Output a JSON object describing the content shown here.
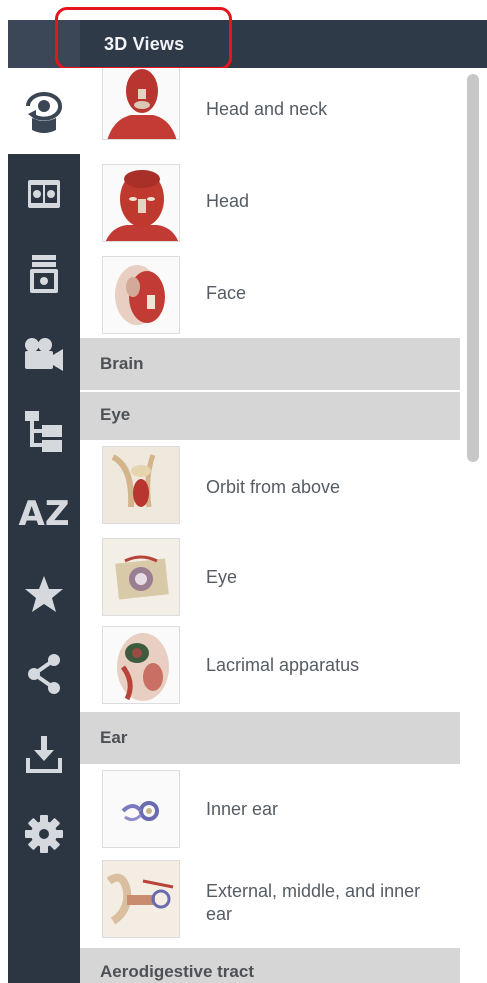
{
  "header": {
    "title": "3D Views"
  },
  "sidebar": {
    "items": [
      {
        "icon": "3d-rotate-icon",
        "active": true
      },
      {
        "icon": "split-panel-icon",
        "active": false
      },
      {
        "icon": "stacked-layers-icon",
        "active": false
      },
      {
        "icon": "video-camera-icon",
        "active": false
      },
      {
        "icon": "hierarchy-tree-icon",
        "active": false
      },
      {
        "icon": "a-to-z-icon",
        "active": false
      },
      {
        "icon": "star-icon",
        "active": false
      },
      {
        "icon": "share-icon",
        "active": false
      },
      {
        "icon": "download-icon",
        "active": false
      },
      {
        "icon": "gear-icon",
        "active": false
      }
    ],
    "az_text": "AZ"
  },
  "list": {
    "items": [
      {
        "kind": "view",
        "label": "Head and neck"
      },
      {
        "kind": "view",
        "label": "Head"
      },
      {
        "kind": "view",
        "label": "Face"
      },
      {
        "kind": "section",
        "label": "Brain"
      },
      {
        "kind": "section",
        "label": "Eye"
      },
      {
        "kind": "view",
        "label": "Orbit from above"
      },
      {
        "kind": "view",
        "label": "Eye"
      },
      {
        "kind": "view",
        "label": "Lacrimal apparatus"
      },
      {
        "kind": "section",
        "label": "Ear"
      },
      {
        "kind": "view",
        "label": "Inner ear"
      },
      {
        "kind": "view",
        "label": "External, middle, and inner ear"
      },
      {
        "kind": "section",
        "label": "Aerodigestive tract"
      }
    ]
  },
  "colors": {
    "header_bg": "#2e3a48",
    "sidebar_bg": "#2b3642",
    "section_bg": "#d6d6d6",
    "highlight": "#e5141e"
  }
}
